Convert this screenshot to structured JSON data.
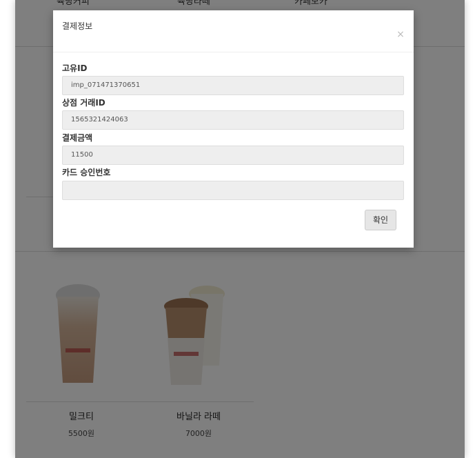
{
  "background": {
    "categories": [
      "육당커피",
      "육당라떼",
      "카페모카"
    ],
    "products": [
      {
        "name": "밀크티",
        "price": "5500원"
      },
      {
        "name": "바닐라 라떼",
        "price": "7000원"
      }
    ]
  },
  "modal": {
    "title": "결제정보",
    "close_symbol": "×",
    "fields": [
      {
        "label": "고유ID",
        "value": "imp_071471370651"
      },
      {
        "label": "상점 거래ID",
        "value": "1565321424063"
      },
      {
        "label": "결제금액",
        "value": "11500"
      },
      {
        "label": "카드 승인번호",
        "value": ""
      }
    ],
    "confirm_label": "확인"
  },
  "colors": {
    "overlay": "#000000",
    "modal_bg": "#ffffff",
    "input_bg": "#eeeeee"
  }
}
